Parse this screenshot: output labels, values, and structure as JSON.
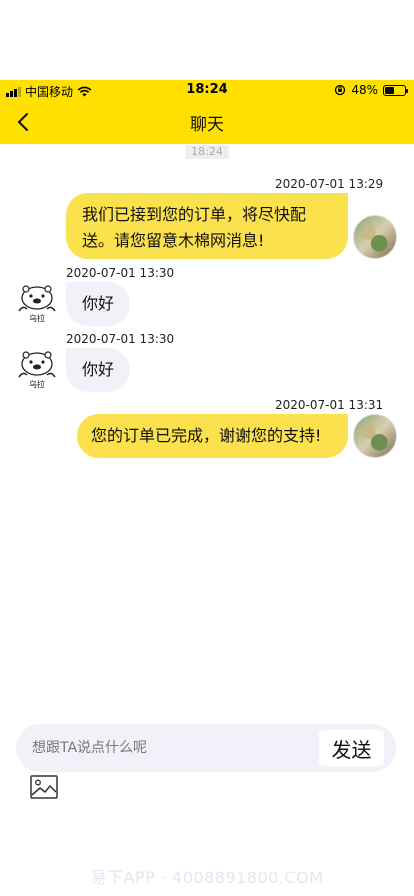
{
  "status_bar": {
    "carrier": "中国移动",
    "time": "18:24",
    "battery": "48%",
    "battery_level": 0.48
  },
  "nav": {
    "title": "聊天"
  },
  "time_chip": "18:24",
  "messages": [
    {
      "direction": "out",
      "timestamp": "2020-07-01 13:29",
      "text_lines": [
        "我们已接到您的订单，将尽快配",
        "送。请您留意木棉网消息!"
      ]
    },
    {
      "direction": "in",
      "timestamp": "2020-07-01 13:30",
      "text": "你好",
      "avatar_label": "乌拉"
    },
    {
      "direction": "in",
      "timestamp": "2020-07-01 13:30",
      "text": "你好",
      "avatar_label": "乌拉"
    },
    {
      "direction": "out",
      "timestamp": "2020-07-01 13:31",
      "text": "您的订单已完成，谢谢您的支持!"
    }
  ],
  "composer": {
    "placeholder": "想跟TA说点什么呢",
    "send_label": "发送"
  },
  "watermark": "易下APP · 4008891800.COM",
  "colors": {
    "accent": "#FFE000",
    "outgoing_bubble": "#FBE14D",
    "incoming_bubble": "#F1F1F9"
  }
}
